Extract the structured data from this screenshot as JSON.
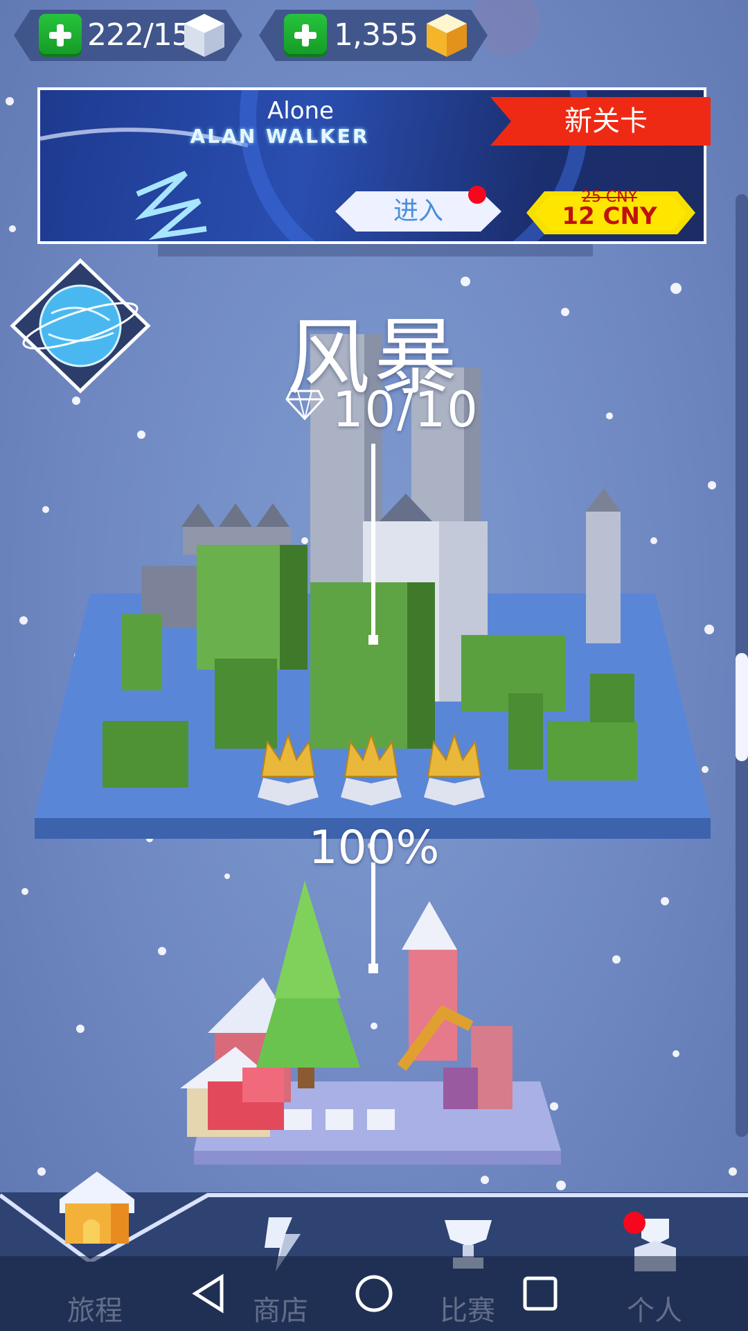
{
  "resources": {
    "cubes": {
      "value": "222/15",
      "icon": "white-cube-icon"
    },
    "gems": {
      "value": "1,355",
      "icon": "gold-cube-icon"
    }
  },
  "banner": {
    "song_title": "Alone",
    "artist": "ALAN WALKER",
    "enter_label": "进入",
    "ribbon": "新关卡",
    "old_price": "25 CNY",
    "new_price": "12 CNY"
  },
  "level": {
    "name": "风暴",
    "gems": "10/10",
    "progress_percent": "100%",
    "crowns": 3
  },
  "tabs": [
    {
      "label": "旅程",
      "icon": "house-icon",
      "active": true
    },
    {
      "label": "商店",
      "icon": "shop-icon",
      "active": false
    },
    {
      "label": "比赛",
      "icon": "trophy-icon",
      "active": false
    },
    {
      "label": "个人",
      "icon": "profile-icon",
      "active": false
    }
  ],
  "colors": {
    "accent_green": "#1fb533",
    "ribbon_red": "#ef2a14",
    "price_yellow": "#ffe600",
    "notification_red": "#f5081d"
  }
}
